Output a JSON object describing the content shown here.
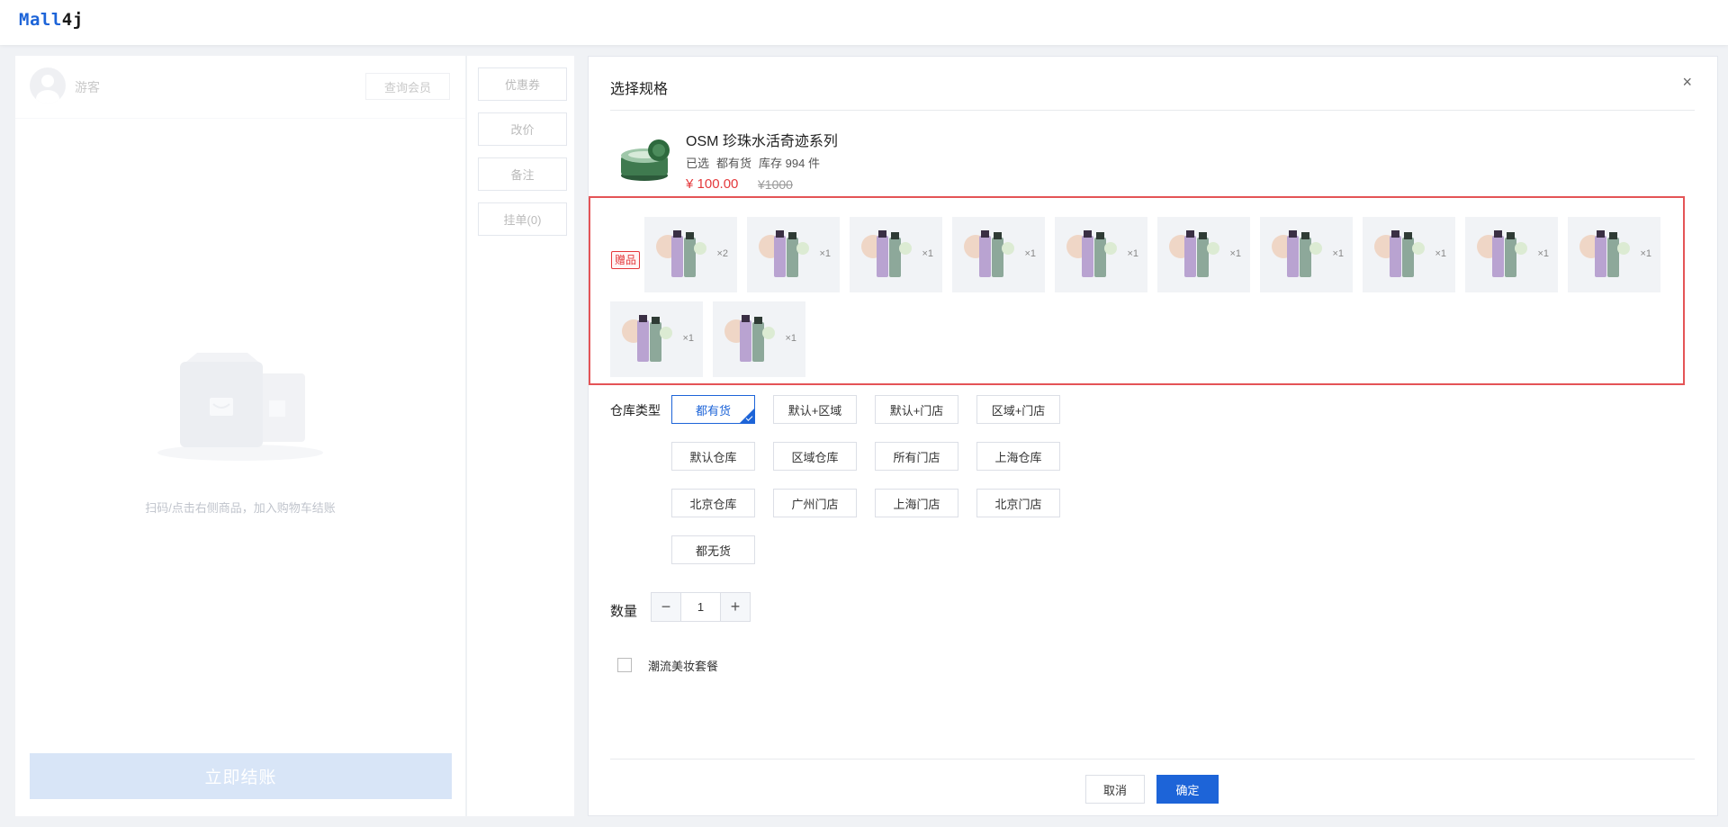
{
  "app": {
    "logo_brand": "Mall",
    "logo_suffix": "4j"
  },
  "left_panel": {
    "guest_name": "游客",
    "query_member_label": "查询会员",
    "empty_tip": "扫码/点击右侧商品，加入购物车结账",
    "checkout_label": "立即结账"
  },
  "side_actions": [
    {
      "label": "优惠券"
    },
    {
      "label": "改价"
    },
    {
      "label": "备注"
    },
    {
      "label": "挂单(0)"
    }
  ],
  "dialog": {
    "title": "选择规格",
    "close_icon": "close-icon",
    "product": {
      "name": "OSM 珍珠水活奇迹系列",
      "selected_prefix": "已选",
      "selected_value": "都有货",
      "stock_text": "库存 994 件",
      "price": "¥ 100.00",
      "original_price": "¥1000"
    },
    "gift_tag": "赠品",
    "gifts": [
      {
        "qty": "×2"
      },
      {
        "qty": "×1"
      },
      {
        "qty": "×1"
      },
      {
        "qty": "×1"
      },
      {
        "qty": "×1"
      },
      {
        "qty": "×1"
      },
      {
        "qty": "×1"
      },
      {
        "qty": "×1"
      },
      {
        "qty": "×1"
      },
      {
        "qty": "×1"
      },
      {
        "qty": "×1"
      },
      {
        "qty": "×1"
      }
    ],
    "warehouse_label": "仓库类型",
    "warehouse_options": [
      "都有货",
      "默认+区域",
      "默认+门店",
      "区域+门店",
      "默认仓库",
      "区域仓库",
      "所有门店",
      "上海仓库",
      "北京仓库",
      "广州门店",
      "上海门店",
      "北京门店",
      "都无货"
    ],
    "selected_warehouse": "都有货",
    "quantity_label": "数量",
    "quantity_value": "1",
    "quantity_minus": "−",
    "quantity_plus": "+",
    "combo_label": "潮流美妆套餐",
    "cancel_label": "取消",
    "confirm_label": "确定"
  },
  "colors": {
    "accent": "#1d64d8",
    "price_red": "#e4393c",
    "highlight_border": "#e45457"
  }
}
